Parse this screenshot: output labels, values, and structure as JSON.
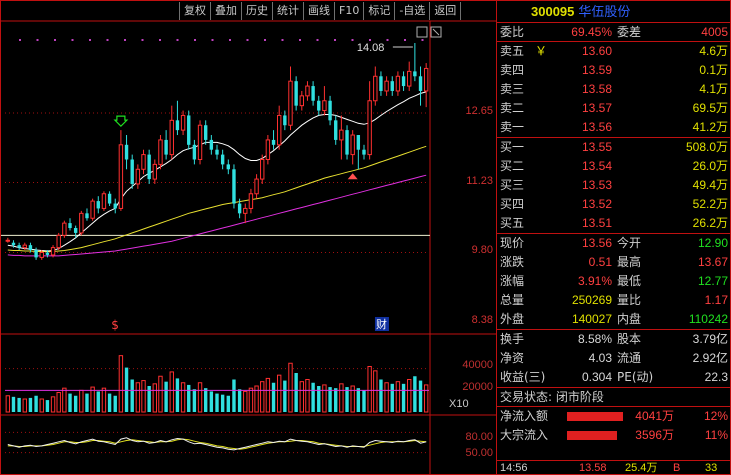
{
  "toolbar": [
    "复权",
    "叠加",
    "历史",
    "统计",
    "画线",
    "F10",
    "标记",
    "-自选",
    "返回"
  ],
  "chart_labels": {
    "high_marker": "14.08",
    "price_ticks": [
      "12.65",
      "11.23",
      "9.80",
      "8.38"
    ],
    "volume_ticks": [
      "40000",
      "20000"
    ],
    "volume_unit": "X10",
    "indicator_ticks": [
      "80.00",
      "50.00"
    ],
    "event_marks": [
      "$",
      "财"
    ]
  },
  "colors": {
    "up": "#ff3030",
    "down": "#30e0e0",
    "ma_short": "#ffffff",
    "ma_mid": "#e8e030",
    "ma_long": "#e030e0",
    "grid": "#a01010",
    "frame": "#c01010"
  },
  "chart_data": {
    "type": "candlestick",
    "price_range": [
      8.38,
      14.08
    ],
    "candles": [
      [
        10.05,
        10.05,
        10.0,
        10.1
      ],
      [
        10.0,
        9.95,
        9.9,
        10.05
      ],
      [
        9.95,
        9.9,
        9.85,
        10.0
      ],
      [
        9.9,
        9.95,
        9.85,
        10.0
      ],
      [
        9.95,
        9.85,
        9.8,
        10.0
      ],
      [
        9.85,
        9.7,
        9.65,
        9.9
      ],
      [
        9.7,
        9.8,
        9.65,
        9.85
      ],
      [
        9.8,
        9.75,
        9.7,
        9.85
      ],
      [
        9.75,
        9.9,
        9.7,
        9.95
      ],
      [
        9.9,
        10.15,
        9.85,
        10.2
      ],
      [
        10.15,
        10.4,
        10.1,
        10.45
      ],
      [
        10.4,
        10.3,
        10.25,
        10.5
      ],
      [
        10.3,
        10.2,
        10.1,
        10.35
      ],
      [
        10.2,
        10.6,
        10.15,
        10.65
      ],
      [
        10.6,
        10.5,
        10.45,
        10.7
      ],
      [
        10.5,
        10.85,
        10.45,
        10.9
      ],
      [
        10.85,
        10.7,
        10.6,
        10.95
      ],
      [
        10.7,
        11.0,
        10.65,
        11.05
      ],
      [
        11.0,
        10.8,
        10.75,
        11.05
      ],
      [
        10.8,
        10.7,
        10.6,
        10.9
      ],
      [
        10.7,
        12.0,
        10.65,
        12.3
      ],
      [
        12.0,
        11.7,
        11.5,
        12.2
      ],
      [
        11.7,
        11.2,
        11.1,
        11.8
      ],
      [
        11.2,
        11.5,
        11.1,
        11.6
      ],
      [
        11.5,
        11.8,
        11.4,
        11.9
      ],
      [
        11.8,
        11.3,
        11.2,
        11.9
      ],
      [
        11.3,
        11.6,
        11.2,
        11.7
      ],
      [
        11.6,
        12.1,
        11.5,
        12.2
      ],
      [
        12.1,
        11.8,
        11.7,
        12.3
      ],
      [
        11.8,
        12.5,
        11.7,
        12.8
      ],
      [
        12.5,
        12.3,
        12.2,
        12.9
      ],
      [
        12.3,
        12.6,
        12.2,
        12.7
      ],
      [
        12.6,
        12.0,
        11.9,
        12.7
      ],
      [
        12.0,
        11.7,
        11.6,
        12.1
      ],
      [
        11.7,
        12.4,
        11.6,
        12.5
      ],
      [
        12.4,
        12.1,
        12.0,
        12.5
      ],
      [
        12.1,
        11.9,
        11.8,
        12.2
      ],
      [
        11.9,
        11.8,
        11.7,
        12.0
      ],
      [
        11.8,
        11.6,
        11.5,
        11.9
      ],
      [
        11.6,
        11.5,
        11.4,
        11.7
      ],
      [
        11.5,
        10.8,
        10.7,
        11.6
      ],
      [
        10.8,
        10.6,
        10.5,
        10.9
      ],
      [
        10.6,
        10.7,
        10.4,
        10.8
      ],
      [
        10.7,
        11.0,
        10.6,
        11.1
      ],
      [
        11.0,
        11.3,
        10.9,
        11.4
      ],
      [
        11.3,
        11.7,
        11.2,
        11.8
      ],
      [
        11.7,
        12.1,
        11.6,
        12.2
      ],
      [
        12.1,
        12.0,
        11.9,
        12.3
      ],
      [
        12.0,
        12.6,
        11.9,
        12.8
      ],
      [
        12.6,
        12.4,
        12.3,
        12.7
      ],
      [
        12.4,
        13.3,
        12.3,
        13.6
      ],
      [
        13.3,
        12.8,
        12.7,
        13.4
      ],
      [
        12.8,
        13.0,
        12.7,
        13.1
      ],
      [
        13.0,
        13.2,
        12.9,
        13.3
      ],
      [
        13.2,
        12.9,
        12.8,
        13.3
      ],
      [
        12.9,
        12.7,
        12.6,
        13.0
      ],
      [
        12.7,
        12.9,
        12.6,
        13.2
      ],
      [
        12.9,
        12.5,
        12.4,
        13.0
      ],
      [
        12.5,
        12.1,
        12.0,
        12.6
      ],
      [
        12.1,
        12.3,
        11.7,
        12.6
      ],
      [
        12.3,
        11.8,
        11.7,
        12.4
      ],
      [
        11.8,
        12.2,
        11.6,
        12.3
      ],
      [
        12.2,
        11.9,
        11.5,
        12.2
      ],
      [
        11.9,
        11.8,
        11.7,
        12.0
      ],
      [
        11.8,
        12.9,
        11.7,
        13.3
      ],
      [
        12.9,
        13.4,
        12.8,
        13.6
      ],
      [
        13.4,
        13.1,
        13.0,
        13.5
      ],
      [
        13.1,
        13.3,
        13.0,
        13.4
      ],
      [
        13.3,
        13.1,
        13.0,
        13.4
      ],
      [
        13.1,
        13.4,
        13.0,
        13.5
      ],
      [
        13.4,
        13.2,
        13.1,
        13.5
      ],
      [
        13.2,
        13.5,
        13.1,
        13.7
      ],
      [
        13.5,
        13.4,
        13.3,
        14.08
      ],
      [
        13.4,
        13.1,
        12.8,
        13.6
      ],
      [
        13.1,
        13.56,
        12.77,
        13.67
      ]
    ],
    "ma_short": [
      9.95,
      9.93,
      9.9,
      9.88,
      9.87,
      9.85,
      9.84,
      9.83,
      9.84,
      9.88,
      9.95,
      10.02,
      10.1,
      10.2,
      10.3,
      10.4,
      10.5,
      10.58,
      10.65,
      10.7,
      10.9,
      11.05,
      11.15,
      11.25,
      11.35,
      11.42,
      11.48,
      11.55,
      11.62,
      11.7,
      11.8,
      11.88,
      11.92,
      11.95,
      12.0,
      12.05,
      12.05,
      12.05,
      12.02,
      11.98,
      11.9,
      11.8,
      11.72,
      11.68,
      11.68,
      11.72,
      11.8,
      11.88,
      11.98,
      12.08,
      12.2,
      12.3,
      12.4,
      12.48,
      12.55,
      12.6,
      12.62,
      12.62,
      12.6,
      12.56,
      12.52,
      12.48,
      12.44,
      12.42,
      12.45,
      12.52,
      12.6,
      12.68,
      12.75,
      12.82,
      12.88,
      12.95,
      13.0,
      13.05,
      13.08
    ],
    "ma_mid": [
      9.85,
      9.84,
      9.84,
      9.83,
      9.83,
      9.82,
      9.82,
      9.82,
      9.82,
      9.83,
      9.84,
      9.86,
      9.88,
      9.9,
      9.93,
      9.96,
      9.99,
      10.02,
      10.05,
      10.08,
      10.12,
      10.16,
      10.2,
      10.24,
      10.28,
      10.32,
      10.36,
      10.4,
      10.44,
      10.48,
      10.52,
      10.56,
      10.6,
      10.63,
      10.66,
      10.69,
      10.72,
      10.75,
      10.78,
      10.8,
      10.82,
      10.84,
      10.86,
      10.88,
      10.9,
      10.92,
      10.95,
      10.98,
      11.01,
      11.04,
      11.08,
      11.12,
      11.16,
      11.2,
      11.24,
      11.28,
      11.32,
      11.35,
      11.38,
      11.41,
      11.44,
      11.47,
      11.5,
      11.53,
      11.57,
      11.61,
      11.65,
      11.69,
      11.73,
      11.77,
      11.81,
      11.85,
      11.89,
      11.93,
      11.97
    ],
    "ma_long": [
      9.75,
      9.74,
      9.74,
      9.73,
      9.73,
      9.73,
      9.73,
      9.73,
      9.73,
      9.73,
      9.74,
      9.75,
      9.76,
      9.77,
      9.78,
      9.79,
      9.8,
      9.81,
      9.82,
      9.83,
      9.85,
      9.87,
      9.89,
      9.91,
      9.93,
      9.95,
      9.97,
      9.99,
      10.01,
      10.03,
      10.06,
      10.09,
      10.12,
      10.15,
      10.18,
      10.21,
      10.24,
      10.27,
      10.3,
      10.33,
      10.36,
      10.39,
      10.42,
      10.45,
      10.48,
      10.51,
      10.54,
      10.57,
      10.6,
      10.63,
      10.66,
      10.69,
      10.72,
      10.75,
      10.78,
      10.81,
      10.84,
      10.87,
      10.9,
      10.93,
      10.96,
      10.99,
      11.02,
      11.05,
      11.08,
      11.11,
      11.14,
      11.17,
      11.2,
      11.23,
      11.26,
      11.29,
      11.32,
      11.35,
      11.38
    ],
    "reference_price": 10.15,
    "volume_range": [
      0,
      60000
    ],
    "volume_reference": 20000,
    "volumes": [
      15000,
      14000,
      13000,
      12000,
      13000,
      15000,
      12000,
      11000,
      14000,
      18000,
      22000,
      17000,
      15000,
      20000,
      17000,
      23000,
      19000,
      22000,
      17000,
      15000,
      52000,
      41000,
      30000,
      27000,
      29000,
      24000,
      26000,
      33000,
      28000,
      37000,
      31000,
      27000,
      25000,
      21000,
      27000,
      22000,
      19000,
      17000,
      16000,
      15000,
      30000,
      21000,
      19000,
      22000,
      24000,
      28000,
      31000,
      27000,
      34000,
      29000,
      45000,
      36000,
      28000,
      30000,
      27000,
      24000,
      25000,
      23000,
      22000,
      26000,
      23000,
      24000,
      22000,
      20000,
      42000,
      38000,
      30000,
      27000,
      26000,
      28000,
      26000,
      30000,
      33000,
      29000,
      25000
    ],
    "indicator_range": [
      30,
      100
    ],
    "indicator_k": [
      62,
      60,
      58,
      60,
      61,
      59,
      60,
      62,
      64,
      66,
      68,
      65,
      63,
      66,
      68,
      70,
      67,
      66,
      64,
      62,
      70,
      72,
      68,
      66,
      67,
      64,
      65,
      68,
      66,
      69,
      71,
      70,
      66,
      63,
      64,
      62,
      60,
      58,
      57,
      55,
      54,
      56,
      58,
      60,
      62,
      64,
      66,
      65,
      67,
      66,
      70,
      68,
      67,
      66,
      64,
      62,
      63,
      61,
      59,
      60,
      58,
      60,
      59,
      58,
      65,
      68,
      67,
      66,
      65,
      67,
      66,
      68,
      69,
      64,
      66
    ],
    "indicator_d": [
      60,
      60,
      59,
      59,
      60,
      60,
      60,
      61,
      62,
      64,
      66,
      66,
      65,
      65,
      66,
      68,
      68,
      67,
      66,
      64,
      66,
      68,
      69,
      68,
      67,
      66,
      65,
      66,
      66,
      67,
      69,
      70,
      69,
      67,
      65,
      64,
      62,
      60,
      59,
      57,
      56,
      55,
      56,
      58,
      60,
      62,
      64,
      65,
      66,
      66,
      67,
      68,
      68,
      67,
      66,
      64,
      63,
      62,
      61,
      60,
      59,
      59,
      59,
      59,
      61,
      63,
      65,
      66,
      66,
      66,
      66,
      67,
      68,
      67,
      66
    ]
  },
  "stock": {
    "code": "300095",
    "name": "华伍股份"
  },
  "quote": {
    "weibi": {
      "label": "委比",
      "value": "69.45%",
      "label2": "委差",
      "value2": "4005"
    },
    "asks": [
      {
        "label": "卖五",
        "flag": "￥",
        "price": "13.60",
        "volume": "4.6万"
      },
      {
        "label": "卖四",
        "price": "13.59",
        "volume": "0.1万"
      },
      {
        "label": "卖三",
        "price": "13.58",
        "volume": "4.1万"
      },
      {
        "label": "卖二",
        "price": "13.57",
        "volume": "69.5万"
      },
      {
        "label": "卖一",
        "price": "13.56",
        "volume": "41.2万"
      }
    ],
    "bids": [
      {
        "label": "买一",
        "price": "13.55",
        "volume": "508.0万"
      },
      {
        "label": "买二",
        "price": "13.54",
        "volume": "26.0万"
      },
      {
        "label": "买三",
        "price": "13.53",
        "volume": "49.4万"
      },
      {
        "label": "买四",
        "price": "13.52",
        "volume": "52.2万"
      },
      {
        "label": "买五",
        "price": "13.51",
        "volume": "26.2万"
      }
    ],
    "stats1": [
      {
        "label": "现价",
        "value": "13.56",
        "label2": "今开",
        "value2": "12.90"
      },
      {
        "label": "涨跌",
        "value": "0.51",
        "label2": "最高",
        "value2": "13.67"
      },
      {
        "label": "涨幅",
        "value": "3.91%",
        "label2": "最低",
        "value2": "12.77"
      },
      {
        "label": "总量",
        "value": "250269",
        "label2": "量比",
        "value2": "1.17"
      },
      {
        "label": "外盘",
        "value": "140027",
        "label2": "内盘",
        "value2": "110242"
      }
    ],
    "stats2": [
      {
        "label": "换手",
        "value": "8.58%",
        "label2": "股本",
        "value2": "3.79亿"
      },
      {
        "label": "净资",
        "value": "4.03",
        "label2": "流通",
        "value2": "2.92亿"
      },
      {
        "label": "收益(三)",
        "value": "0.304",
        "label2": "PE(动)",
        "value2": "22.3"
      }
    ],
    "status": "交易状态: 闭市阶段",
    "flows": [
      {
        "label": "净流入额",
        "value": "4041万",
        "pct": "12%",
        "fill": 0.85
      },
      {
        "label": "大宗流入",
        "value": "3596万",
        "pct": "11%",
        "fill": 0.75
      }
    ],
    "last_tick": {
      "time": "14:56",
      "price": "13.58",
      "volume": "25.4万",
      "side": "B",
      "count": "33"
    }
  }
}
